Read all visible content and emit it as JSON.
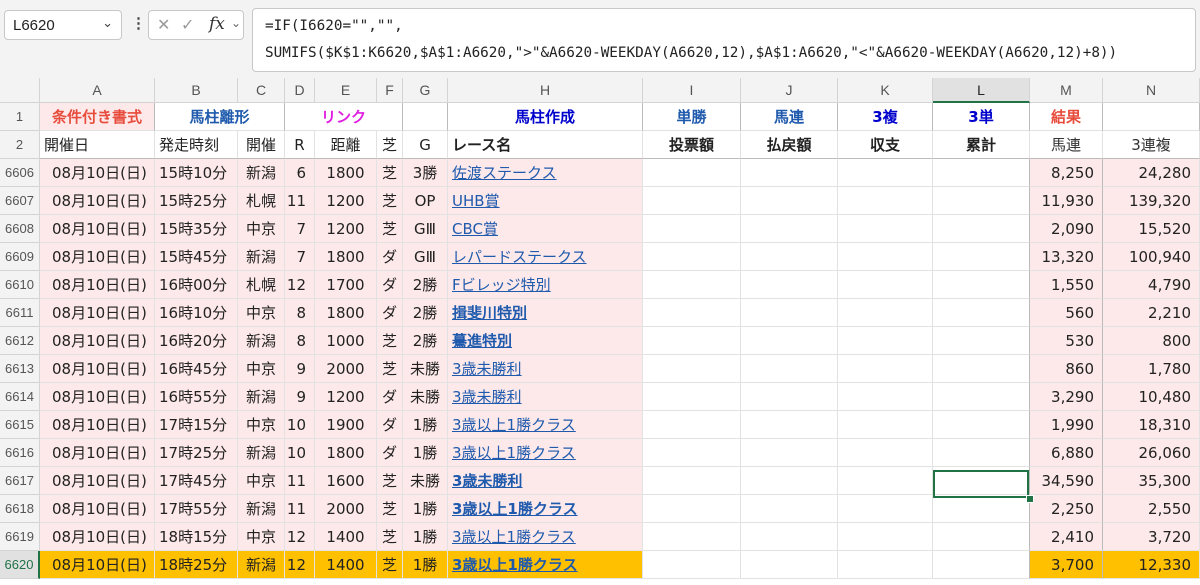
{
  "formula_bar": {
    "name_box": "L6620",
    "cancel_glyph": "✕",
    "enter_glyph": "✓",
    "fx_label": "fx",
    "formula_line1": "=IF(I6620=\"\",\"\",",
    "formula_line2": "SUMIFS($K$1:K6620,$A$1:A6620,\">\"&A6620-WEEKDAY(A6620,12),$A$1:A6620,\"<\"&A6620-WEEKDAY(A6620,12)+8))"
  },
  "columns": [
    "A",
    "B",
    "C",
    "D",
    "E",
    "F",
    "G",
    "H",
    "I",
    "J",
    "K",
    "L",
    "M",
    "N"
  ],
  "selected_column": "L",
  "row1": {
    "row_num": "1",
    "a": "条件付き書式",
    "bc": "馬柱離形",
    "df": "リンク",
    "h": "馬柱作成",
    "i": "単勝",
    "j": "馬連",
    "k": "3複",
    "l": "3単",
    "m": "結果"
  },
  "row2": {
    "row_num": "2",
    "cells": [
      "開催日",
      "発走時刻",
      "開催",
      "R",
      "距離",
      "芝",
      "G",
      "レース名",
      "投票額",
      "払戻額",
      "収支",
      "累計",
      "馬連",
      "3連複"
    ]
  },
  "rows": [
    {
      "num": "6606",
      "date": "08月10日(日)",
      "time": "15時10分",
      "venue": "新潟",
      "r": "6",
      "dist": "1800",
      "surf": "芝",
      "grade": "3勝",
      "name": "佐渡ステークス",
      "bold": false,
      "umaren": "8,250",
      "sanrenpuku": "24,280"
    },
    {
      "num": "6607",
      "date": "08月10日(日)",
      "time": "15時25分",
      "venue": "札幌",
      "r": "11",
      "dist": "1200",
      "surf": "芝",
      "grade": "OP",
      "name": "UHB賞",
      "bold": false,
      "umaren": "11,930",
      "sanrenpuku": "139,320"
    },
    {
      "num": "6608",
      "date": "08月10日(日)",
      "time": "15時35分",
      "venue": "中京",
      "r": "7",
      "dist": "1200",
      "surf": "芝",
      "grade": "GⅢ",
      "name": "CBC賞",
      "bold": false,
      "umaren": "2,090",
      "sanrenpuku": "15,520"
    },
    {
      "num": "6609",
      "date": "08月10日(日)",
      "time": "15時45分",
      "venue": "新潟",
      "r": "7",
      "dist": "1800",
      "surf": "ダ",
      "grade": "GⅢ",
      "name": "レパードステークス",
      "bold": false,
      "umaren": "13,320",
      "sanrenpuku": "100,940"
    },
    {
      "num": "6610",
      "date": "08月10日(日)",
      "time": "16時00分",
      "venue": "札幌",
      "r": "12",
      "dist": "1700",
      "surf": "ダ",
      "grade": "2勝",
      "name": "Fビレッジ特別",
      "bold": false,
      "umaren": "1,550",
      "sanrenpuku": "4,790"
    },
    {
      "num": "6611",
      "date": "08月10日(日)",
      "time": "16時10分",
      "venue": "中京",
      "r": "8",
      "dist": "1800",
      "surf": "ダ",
      "grade": "2勝",
      "name": "揖斐川特別",
      "bold": true,
      "umaren": "560",
      "sanrenpuku": "2,210"
    },
    {
      "num": "6612",
      "date": "08月10日(日)",
      "time": "16時20分",
      "venue": "新潟",
      "r": "8",
      "dist": "1000",
      "surf": "芝",
      "grade": "2勝",
      "name": "驀進特別",
      "bold": true,
      "umaren": "530",
      "sanrenpuku": "800"
    },
    {
      "num": "6613",
      "date": "08月10日(日)",
      "time": "16時45分",
      "venue": "中京",
      "r": "9",
      "dist": "2000",
      "surf": "芝",
      "grade": "未勝",
      "name": "3歳未勝利",
      "bold": false,
      "umaren": "860",
      "sanrenpuku": "1,780"
    },
    {
      "num": "6614",
      "date": "08月10日(日)",
      "time": "16時55分",
      "venue": "新潟",
      "r": "9",
      "dist": "1200",
      "surf": "ダ",
      "grade": "未勝",
      "name": "3歳未勝利",
      "bold": false,
      "umaren": "3,290",
      "sanrenpuku": "10,480"
    },
    {
      "num": "6615",
      "date": "08月10日(日)",
      "time": "17時15分",
      "venue": "中京",
      "r": "10",
      "dist": "1900",
      "surf": "ダ",
      "grade": "1勝",
      "name": "3歳以上1勝クラス",
      "bold": false,
      "umaren": "1,990",
      "sanrenpuku": "18,310"
    },
    {
      "num": "6616",
      "date": "08月10日(日)",
      "time": "17時25分",
      "venue": "新潟",
      "r": "10",
      "dist": "1800",
      "surf": "ダ",
      "grade": "1勝",
      "name": "3歳以上1勝クラス",
      "bold": false,
      "umaren": "6,880",
      "sanrenpuku": "26,060"
    },
    {
      "num": "6617",
      "date": "08月10日(日)",
      "time": "17時45分",
      "venue": "中京",
      "r": "11",
      "dist": "1600",
      "surf": "芝",
      "grade": "未勝",
      "name": "3歳未勝利",
      "bold": true,
      "umaren": "34,590",
      "sanrenpuku": "35,300"
    },
    {
      "num": "6618",
      "date": "08月10日(日)",
      "time": "17時55分",
      "venue": "新潟",
      "r": "11",
      "dist": "2000",
      "surf": "芝",
      "grade": "1勝",
      "name": "3歳以上1勝クラス",
      "bold": true,
      "umaren": "2,250",
      "sanrenpuku": "2,550"
    },
    {
      "num": "6619",
      "date": "08月10日(日)",
      "time": "18時15分",
      "venue": "中京",
      "r": "12",
      "dist": "1400",
      "surf": "芝",
      "grade": "1勝",
      "name": "3歳以上1勝クラス",
      "bold": false,
      "umaren": "2,410",
      "sanrenpuku": "3,720"
    },
    {
      "num": "6620",
      "date": "08月10日(日)",
      "time": "18時25分",
      "venue": "新潟",
      "r": "12",
      "dist": "1400",
      "surf": "芝",
      "grade": "1勝",
      "name": "3歳以上1勝クラス",
      "bold": true,
      "umaren": "3,700",
      "sanrenpuku": "12,330",
      "active": true
    }
  ],
  "colors": {
    "row_fill": "#fde9e9",
    "active_row_fill": "#ffc000",
    "link": "#1f5aad",
    "header_red": "#e74c3c",
    "header_blue": "#1f5aad",
    "header_magenta": "#e01ee0",
    "header_darkblue": "#0000cc",
    "selection": "#217346"
  }
}
